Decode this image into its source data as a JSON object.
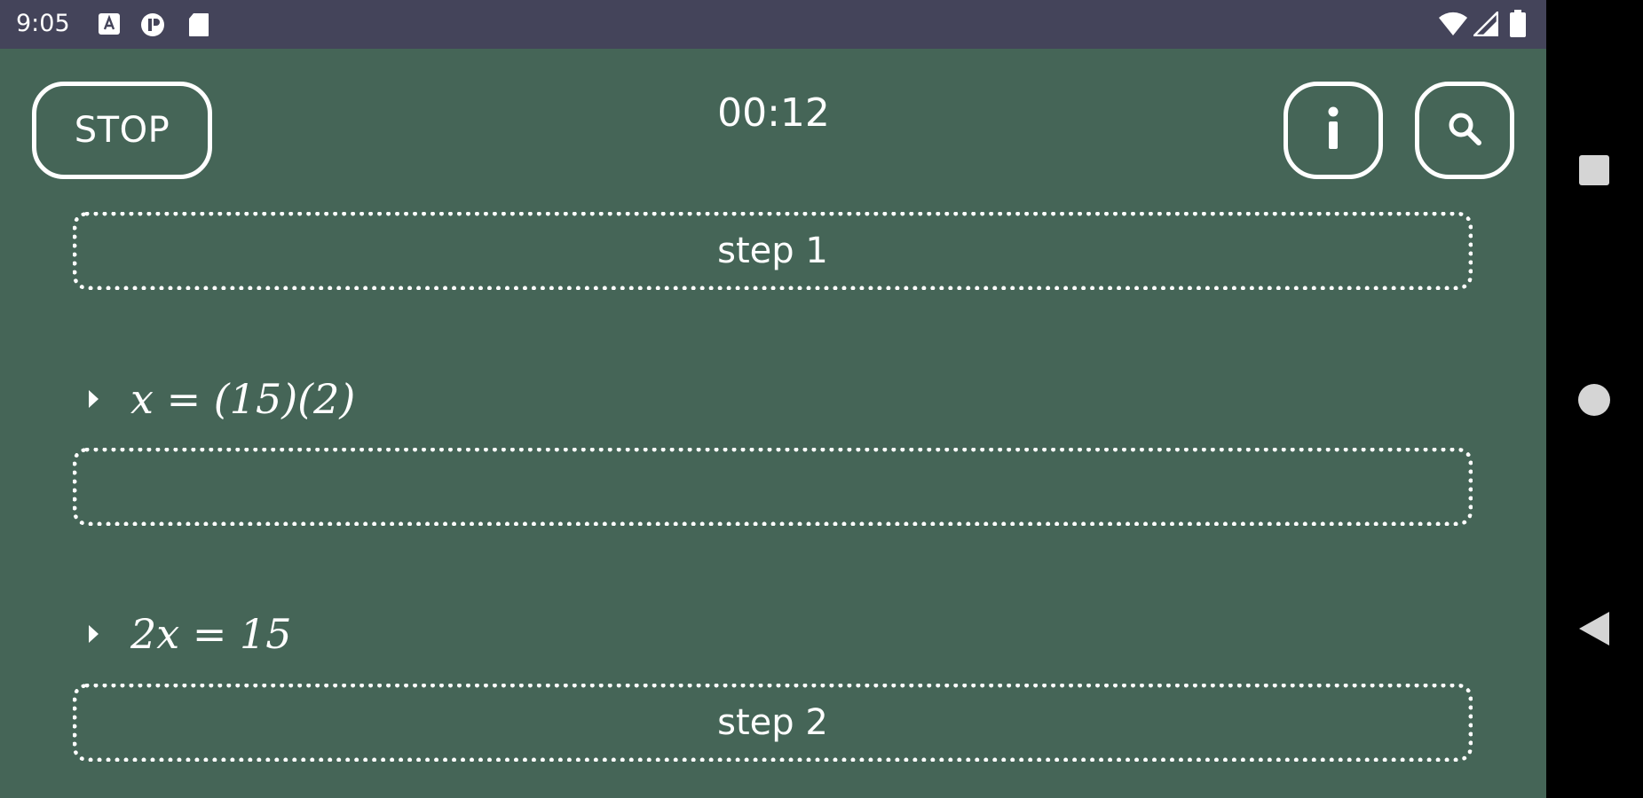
{
  "status_bar": {
    "time": "9:05",
    "left_icons": [
      "a-notification-icon",
      "record-notification-icon",
      "sd-card-icon"
    ],
    "right_icons": [
      "wifi-icon",
      "cell-signal-icon",
      "battery-icon"
    ]
  },
  "toolbar": {
    "stop_label": "STOP",
    "timer": "00:12",
    "info_icon": "info-icon",
    "search_icon": "search-icon"
  },
  "steps": [
    {
      "label": "step 1"
    },
    {
      "label": ""
    },
    {
      "label": "step 2"
    }
  ],
  "equations": [
    {
      "text": "x = (15)(2)"
    },
    {
      "text": "2x = 15"
    }
  ],
  "nav_bar": {
    "icons": [
      "recents-square-icon",
      "home-circle-icon",
      "back-triangle-icon"
    ]
  },
  "colors": {
    "background": "#456557",
    "status_bar": "#44445a",
    "foreground": "#ffffff",
    "nav_bar": "#000000"
  }
}
